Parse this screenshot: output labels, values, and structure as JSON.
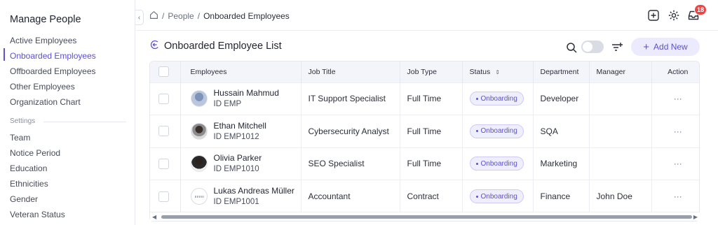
{
  "sidebar": {
    "title": "Manage People",
    "items": [
      {
        "label": "Active Employees"
      },
      {
        "label": "Onboarded Employees",
        "active": true
      },
      {
        "label": "Offboarded Employees"
      },
      {
        "label": "Other Employees"
      },
      {
        "label": "Organization Chart"
      }
    ],
    "settings_label": "Settings",
    "settings_items": [
      {
        "label": "Team"
      },
      {
        "label": "Notice Period"
      },
      {
        "label": "Education"
      },
      {
        "label": "Ethnicities"
      },
      {
        "label": "Gender"
      },
      {
        "label": "Veteran Status"
      }
    ],
    "collapse_icon": "chevron-left-icon"
  },
  "topbar": {
    "breadcrumb": {
      "home_icon": "home-icon",
      "separator": "/",
      "items": [
        "People",
        "Onboarded Employees"
      ]
    },
    "icons": [
      "plus-square-icon",
      "gear-icon",
      "inbox-icon"
    ],
    "notification_count": "18"
  },
  "list": {
    "title": "Onboarded Employee List",
    "back_icon": "back-arrow-icon",
    "search_icon": "search-icon",
    "filter_icon": "filter-icon",
    "add_button": "Add New",
    "add_icon": "plus-icon"
  },
  "table": {
    "columns": [
      "Employees",
      "Job Title",
      "Job Type",
      "Status",
      "Department",
      "Manager",
      "Action"
    ],
    "sort_icon": "sort-icon",
    "rows": [
      {
        "name": "Hussain Mahmud",
        "id": "ID EMP",
        "job_title": "IT Support Specialist",
        "job_type": "Full Time",
        "status": "Onboarding",
        "department": "Developer",
        "manager": "",
        "action": "···"
      },
      {
        "name": "Ethan Mitchell",
        "id": "ID EMP1012",
        "job_title": "Cybersecurity Analyst",
        "job_type": "Full Time",
        "status": "Onboarding",
        "department": "SQA",
        "manager": "",
        "action": "···"
      },
      {
        "name": "Olivia Parker",
        "id": "ID EMP1010",
        "job_title": "SEO Specialist",
        "job_type": "Full Time",
        "status": "Onboarding",
        "department": "Marketing",
        "manager": "",
        "action": "···"
      },
      {
        "name": "Lukas Andreas Müller",
        "id": "ID EMP1001",
        "job_title": "Accountant",
        "job_type": "Contract",
        "status": "Onboarding",
        "department": "Finance",
        "manager": "John Doe",
        "action": "···"
      }
    ]
  },
  "colors": {
    "accent": "#5b50d6",
    "badge": "#ef4444",
    "header_bg": "#f3f5fb"
  }
}
